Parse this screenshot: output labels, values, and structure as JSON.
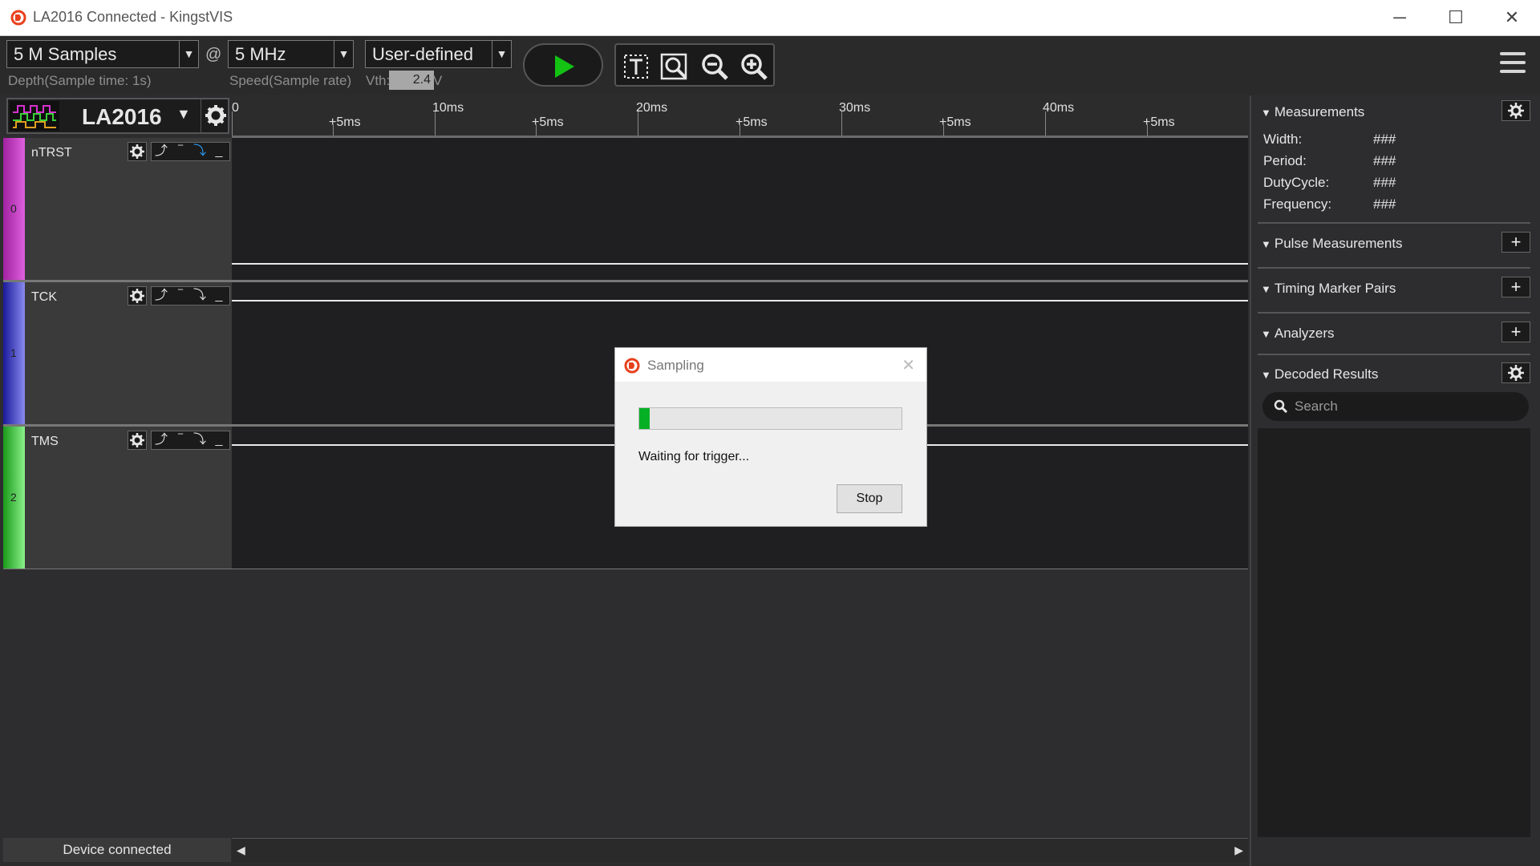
{
  "window": {
    "title": "LA2016 Connected - KingstVIS",
    "minimize_glyph": "─",
    "maximize_glyph": "☐",
    "close_glyph": "✕"
  },
  "toolbar": {
    "depth_value": "5 M Samples",
    "depth_label": "Depth(Sample time: 1s)",
    "at_symbol": "@",
    "speed_value": "5 MHz",
    "speed_label": "Speed(Sample rate)",
    "threshold_value": "User-defined",
    "vth_label": "Vth:",
    "vth_value": "2.4",
    "vth_unit": "V",
    "run_icon": "play-icon",
    "tools": [
      "text-cursor-icon",
      "zoom-fit-icon",
      "zoom-out-icon",
      "zoom-in-icon"
    ],
    "menu_icon": "hamburger-menu-icon"
  },
  "device": {
    "name": "LA2016"
  },
  "ruler": {
    "major": [
      "0",
      "10ms",
      "20ms",
      "30ms",
      "40ms"
    ],
    "minor": [
      "+5ms",
      "+5ms",
      "+5ms",
      "+5ms",
      "+5ms"
    ]
  },
  "channels": [
    {
      "index": "0",
      "name": "nTRST",
      "color": "#d631d0",
      "active_trigger": 2
    },
    {
      "index": "1",
      "name": "TCK",
      "color": "#2a2fd4",
      "active_trigger": -1
    },
    {
      "index": "2",
      "name": "TMS",
      "color": "#2bd42a",
      "active_trigger": -1
    }
  ],
  "status": {
    "text": "Device connected"
  },
  "panel": {
    "measurements": {
      "title": "Measurements",
      "rows": [
        {
          "label": "Width:",
          "value": "###"
        },
        {
          "label": "Period:",
          "value": "###"
        },
        {
          "label": "DutyCycle:",
          "value": "###"
        },
        {
          "label": "Frequency:",
          "value": "###"
        }
      ]
    },
    "pulse_title": "Pulse Measurements",
    "timing_title": "Timing Marker Pairs",
    "analyzers_title": "Analyzers",
    "decoded_title": "Decoded Results",
    "search_placeholder": "Search"
  },
  "dialog": {
    "title": "Sampling",
    "message": "Waiting for trigger...",
    "progress": 0.04,
    "stop_label": "Stop"
  }
}
